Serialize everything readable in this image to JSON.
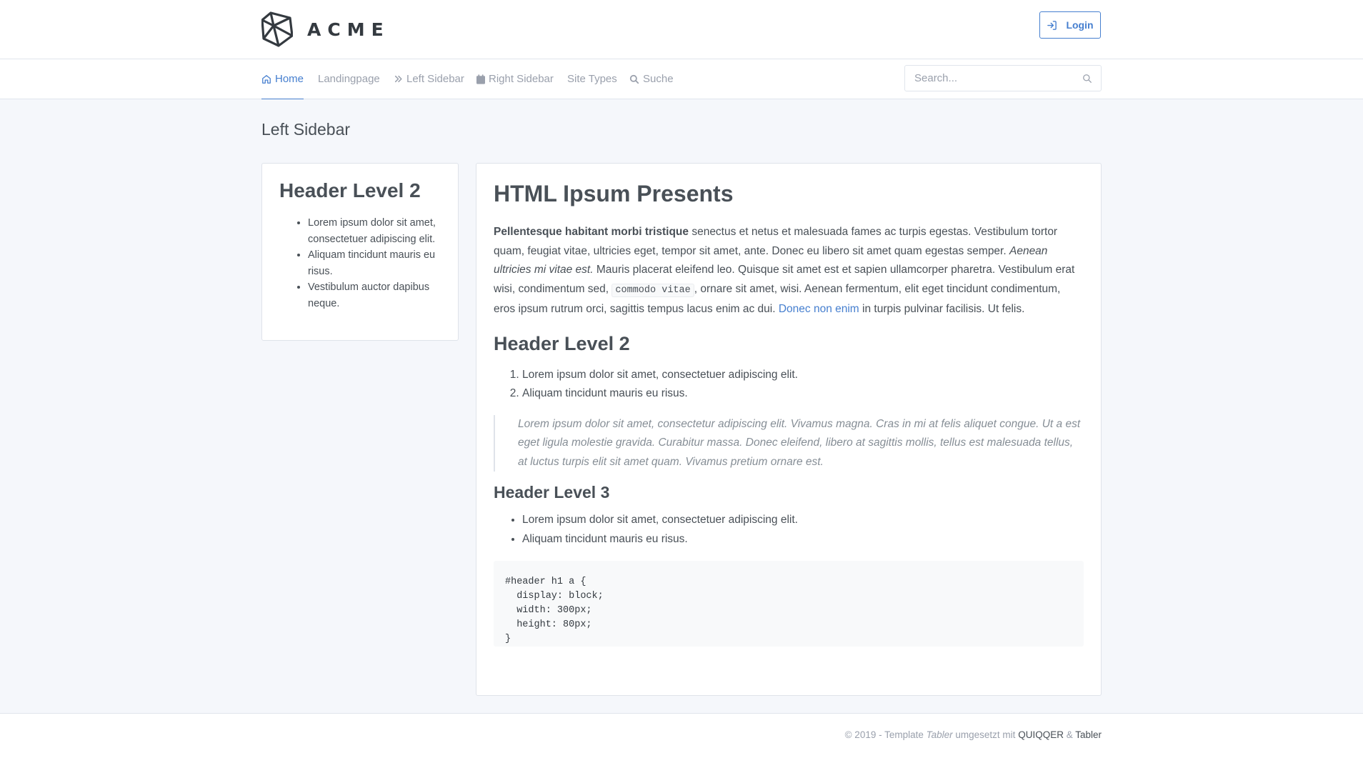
{
  "header": {
    "logo_text": "ACME",
    "login_label": "Login"
  },
  "nav": {
    "items": [
      {
        "label": "Home",
        "icon": "home-icon",
        "active": true
      },
      {
        "label": "Landingpage"
      },
      {
        "label": "Left Sidebar",
        "icon": "double-chevron-right-icon"
      },
      {
        "label": "Right Sidebar",
        "icon": "calendar-icon"
      },
      {
        "label": "Site Types"
      },
      {
        "label": "Suche",
        "icon": "search-icon"
      }
    ],
    "search_placeholder": "Search..."
  },
  "page_title": "Left Sidebar",
  "sidebar_card": {
    "heading": "Header Level 2",
    "items": [
      "Lorem ipsum dolor sit amet, consectetuer adipiscing elit.",
      "Aliquam tincidunt mauris eu risus.",
      "Vestibulum auctor dapibus neque."
    ]
  },
  "main_card": {
    "title": "HTML Ipsum Presents",
    "paragraph": {
      "bold": "Pellentesque habitant morbi tristique",
      "text1": " senectus et netus et malesuada fames ac turpis egestas. Vestibulum tortor quam, feugiat vitae, ultricies eget, tempor sit amet, ante. Donec eu libero sit amet quam egestas semper. ",
      "italic": "Aenean ultricies mi vitae est.",
      "text2": " Mauris placerat eleifend leo. Quisque sit amet est et sapien ullamcorper pharetra. Vestibulum erat wisi, condimentum sed, ",
      "code": "commodo vitae",
      "text3": ", ornare sit amet, wisi. Aenean fermentum, elit eget tincidunt condimentum, eros ipsum rutrum orci, sagittis tempus lacus enim ac dui. ",
      "link": "Donec non enim",
      "text4": " in turpis pulvinar facilisis. Ut felis."
    },
    "h2": "Header Level 2",
    "ordered_items": [
      "Lorem ipsum dolor sit amet, consectetuer adipiscing elit.",
      "Aliquam tincidunt mauris eu risus."
    ],
    "blockquote": "Lorem ipsum dolor sit amet, consectetur adipiscing elit. Vivamus magna. Cras in mi at felis aliquet congue. Ut a est eget ligula molestie gravida. Curabitur massa. Donec eleifend, libero at sagittis mollis, tellus est malesuada tellus, at luctus turpis elit sit amet quam. Vivamus pretium ornare est.",
    "h3": "Header Level 3",
    "unordered_items": [
      "Lorem ipsum dolor sit amet, consectetuer adipiscing elit.",
      "Aliquam tincidunt mauris eu risus."
    ],
    "code_block": "#header h1 a {\n  display: block;\n  width: 300px;\n  height: 80px;\n}"
  },
  "footer": {
    "prefix": "© 2019 - Template ",
    "template_name": "Tabler",
    "middle": " umgesetzt mit ",
    "link1": "QUIQQER",
    "amp": " & ",
    "link2": "Tabler"
  },
  "colors": {
    "accent": "#467fcf",
    "background": "#f5f7fb",
    "muted": "#9aa0ac"
  }
}
